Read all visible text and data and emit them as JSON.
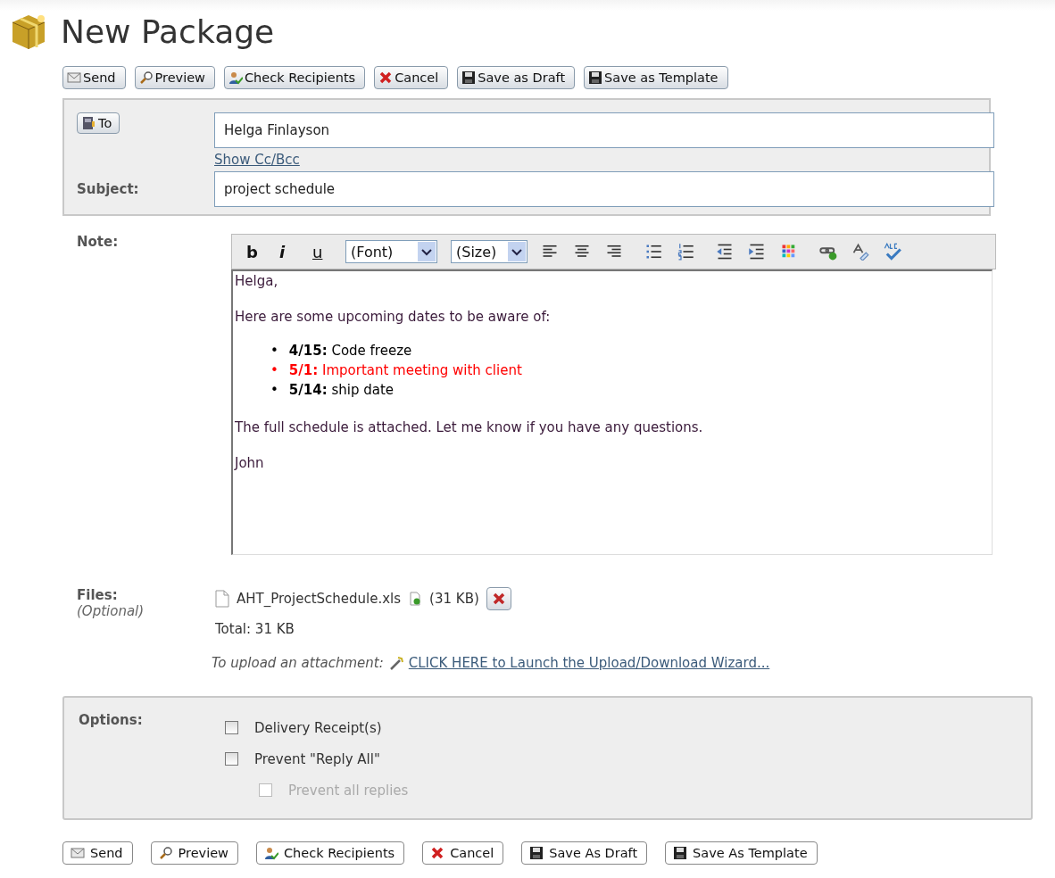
{
  "page": {
    "title": "New Package"
  },
  "top_toolbar": [
    {
      "kind": "send",
      "label": "Send"
    },
    {
      "kind": "preview",
      "label": "Preview"
    },
    {
      "kind": "check",
      "label": "Check Recipients"
    },
    {
      "kind": "cancel",
      "label": "Cancel"
    },
    {
      "kind": "save",
      "label": "Save as Draft"
    },
    {
      "kind": "save",
      "label": "Save as Template"
    }
  ],
  "header": {
    "to_button": "To",
    "to_value": "Helga Finlayson",
    "cc_link": "Show Cc/Bcc",
    "subject_label": "Subject:",
    "subject_value": "project schedule"
  },
  "note": {
    "label": "Note:",
    "toolbar": [
      {
        "kind": "text",
        "label": "b"
      },
      {
        "kind": "text-italic",
        "label": "i"
      },
      {
        "kind": "text-underline",
        "label": "u"
      },
      {
        "kind": "select",
        "label": "(Font)"
      },
      {
        "kind": "select",
        "label": "(Size)"
      },
      {
        "kind": "align-left"
      },
      {
        "kind": "align-center"
      },
      {
        "kind": "align-right"
      },
      {
        "kind": "bullets"
      },
      {
        "kind": "numbers"
      },
      {
        "kind": "outdent"
      },
      {
        "kind": "indent"
      },
      {
        "kind": "palette"
      },
      {
        "kind": "link"
      },
      {
        "kind": "style"
      },
      {
        "kind": "spell"
      }
    ],
    "body": [
      {
        "kind": "para",
        "text": "Helga,"
      },
      {
        "kind": "para",
        "text": "Here are some upcoming dates to be aware of:"
      },
      {
        "kind": "list",
        "items": [
          {
            "marker": "•",
            "text": "**4/15:** Code freeze",
            "color": "#000000"
          },
          {
            "marker": "•",
            "text": "**5/1:** Important meeting with client",
            "color": "#ff0000"
          },
          {
            "marker": "•",
            "text": "**5/14:** ship date",
            "color": "#000000"
          }
        ]
      },
      {
        "kind": "para",
        "text": "The full schedule is attached. Let me know if you have any questions."
      },
      {
        "kind": "para",
        "text": "John"
      }
    ]
  },
  "files": {
    "label": "Files:",
    "hint": "(Optional)",
    "items": [
      {
        "name": "AHT_ProjectSchedule.xls",
        "size": "(31 KB)"
      }
    ],
    "total": "Total: 31 KB",
    "upload_prompt": "To upload an attachment:",
    "upload_link": "CLICK HERE to Launch the Upload/Download Wizard..."
  },
  "options": {
    "label": "Options:",
    "items": [
      {
        "label": "Delivery Receipt(s)",
        "checked": false,
        "disabled": false,
        "nested": false
      },
      {
        "label": "Prevent \"Reply All\"",
        "checked": false,
        "disabled": false,
        "nested": false
      },
      {
        "label": "Prevent all replies",
        "checked": false,
        "disabled": true,
        "nested": true
      }
    ]
  },
  "bottom_toolbar": [
    {
      "kind": "send",
      "label": "Send"
    },
    {
      "kind": "preview",
      "label": "Preview"
    },
    {
      "kind": "check",
      "label": "Check Recipients"
    },
    {
      "kind": "cancel",
      "label": "Cancel"
    },
    {
      "kind": "save",
      "label": "Save As Draft"
    },
    {
      "kind": "save",
      "label": "Save As Template"
    }
  ]
}
